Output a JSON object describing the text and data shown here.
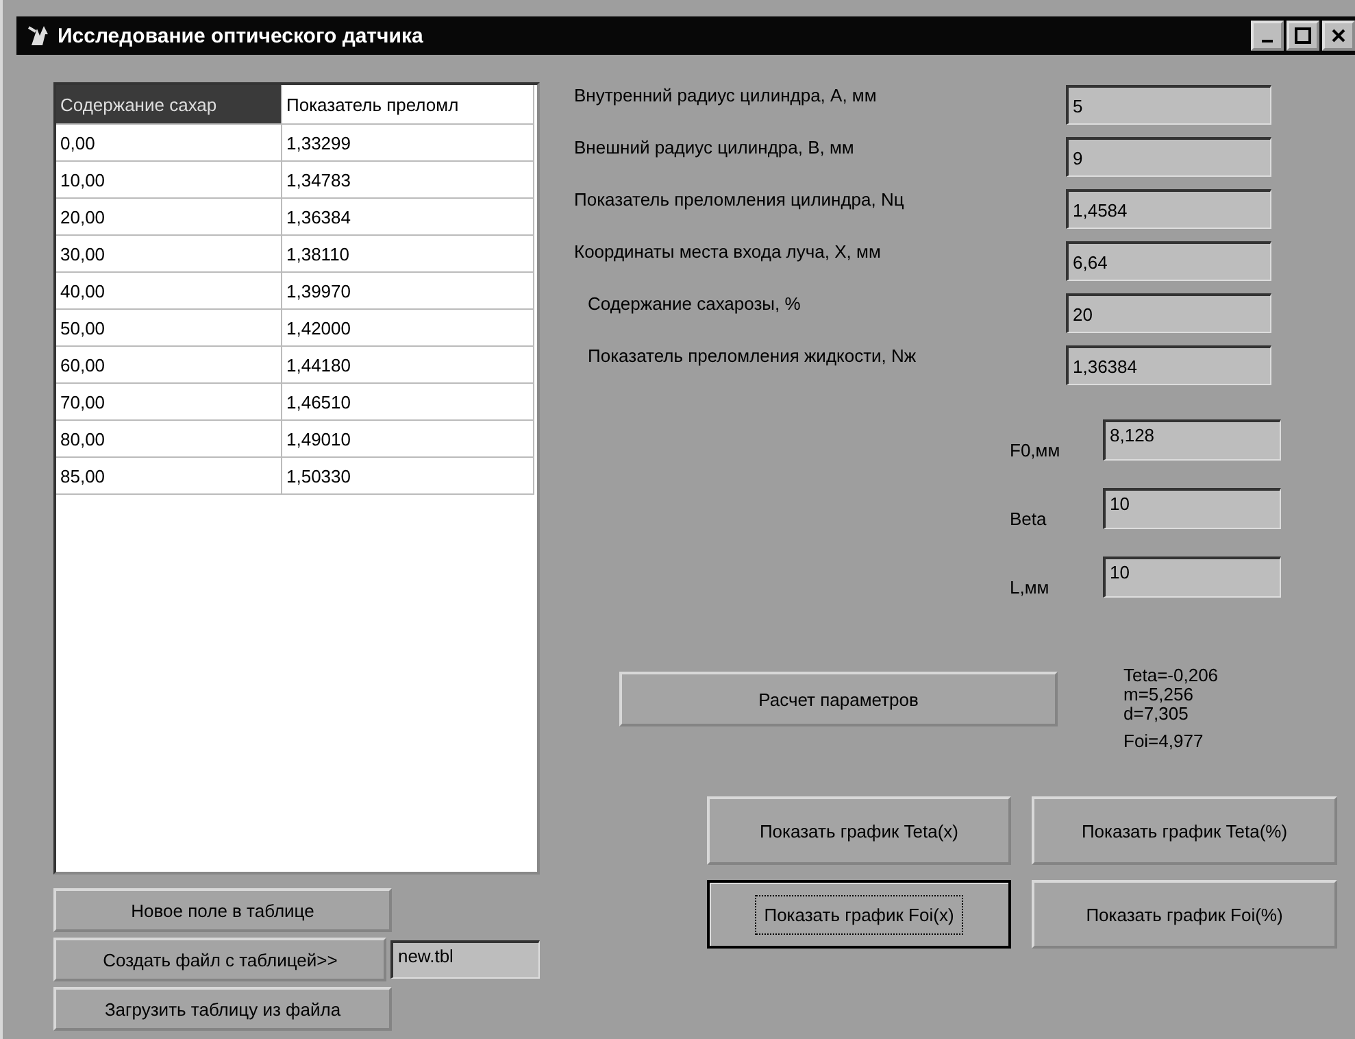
{
  "window": {
    "title": "Исследование оптического датчика"
  },
  "table": {
    "columns": [
      {
        "label": "Содержание сахар",
        "selected": true
      },
      {
        "label": "Показатель преломл",
        "selected": false
      }
    ],
    "rows": [
      [
        "0,00",
        "1,33299"
      ],
      [
        "10,00",
        "1,34783"
      ],
      [
        "20,00",
        "1,36384"
      ],
      [
        "30,00",
        "1,38110"
      ],
      [
        "40,00",
        "1,39970"
      ],
      [
        "50,00",
        "1,42000"
      ],
      [
        "60,00",
        "1,44180"
      ],
      [
        "70,00",
        "1,46510"
      ],
      [
        "80,00",
        "1,49010"
      ],
      [
        "85,00",
        "1,50330"
      ]
    ]
  },
  "table_buttons": [
    {
      "label": "Новое поле в таблице"
    },
    {
      "label": "Создать файл с таблицей>>",
      "file_field": {
        "value": "new.tbl"
      }
    },
    {
      "label": "Загрузить таблицу из файла"
    }
  ],
  "parameters": [
    {
      "label": "Внутренний радиус цилиндра, А, мм",
      "value": "5",
      "indented": false
    },
    {
      "label": "Внешний радиус цилиндра, В, мм",
      "value": "9",
      "indented": false
    },
    {
      "label": "Показатель преломления цилиндра, Nц",
      "value": "1,4584",
      "indented": false
    },
    {
      "label": "Координаты места входа луча, X, мм",
      "value": "6,64",
      "indented": false
    },
    {
      "label": "Содержание сахарозы, %",
      "value": "20",
      "indented": true
    },
    {
      "label": "Показатель преломления жидкости, Nж",
      "value": "1,36384",
      "indented": true
    }
  ],
  "extra_parameters": [
    {
      "label": "F0,мм",
      "value": "8,128"
    },
    {
      "label": "Beta",
      "value": "10"
    },
    {
      "label": "L,мм",
      "value": "10"
    }
  ],
  "calc_button": {
    "label": "Расчет параметров"
  },
  "results": [
    "Teta=-0,206",
    "m=5,256",
    "d=7,305",
    "Foi=4,977"
  ],
  "chart_buttons": [
    {
      "label": "Показать график Teta(x)",
      "focused": false
    },
    {
      "label": "Показать график Teta(%)",
      "focused": false
    },
    {
      "label": "Показать график Foi(x)",
      "focused": true
    },
    {
      "label": "Показать график Foi(%)",
      "focused": false
    }
  ]
}
